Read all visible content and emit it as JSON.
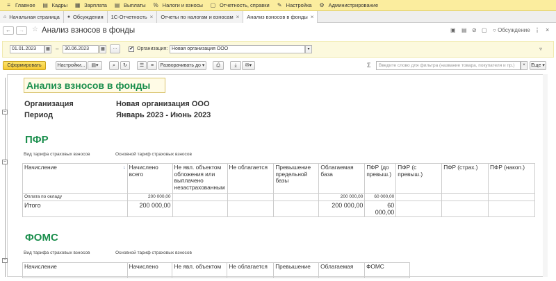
{
  "menu": [
    {
      "icon": "≡",
      "label": "Главное"
    },
    {
      "icon": "▤",
      "label": "Кадры"
    },
    {
      "icon": "▦",
      "label": "Зарплата"
    },
    {
      "icon": "▤",
      "label": "Выплаты"
    },
    {
      "icon": "%",
      "label": "Налоги и взносы"
    },
    {
      "icon": "▢",
      "label": "Отчетность, справки"
    },
    {
      "icon": "✎",
      "label": "Настройка"
    },
    {
      "icon": "⚙",
      "label": "Администрирование"
    }
  ],
  "tabs": [
    {
      "icon": "⌂",
      "label": "Начальная страница",
      "closable": false
    },
    {
      "icon": "●",
      "label": "Обсуждения",
      "closable": false
    },
    {
      "label": "1С-Отчетность",
      "closable": true
    },
    {
      "label": "Отчеты по налогам и взносам",
      "closable": true
    },
    {
      "label": "Анализ взносов в фонды",
      "closable": true
    }
  ],
  "window": {
    "title": "Анализ взносов в фонды",
    "discussion": "Обсуждение"
  },
  "filter": {
    "date_from": "01.01.2023",
    "date_to": "30.06.2023",
    "dots": "...",
    "org_label": "Организация:",
    "org_value": "Новая организация ООО",
    "org_checked": "✔"
  },
  "toolbar": {
    "generate": "Сформировать",
    "settings": "Настройки...",
    "expand": "Разворачивать до",
    "search_placeholder": "Введите слово для фильтра (название товара, покупателя и пр.)",
    "more": "Еще"
  },
  "report": {
    "title": "Анализ взносов в фонды",
    "org_label": "Организация",
    "org_value": "Новая организация ООО",
    "period_label": "Период",
    "period_value": "Январь 2023 - Июнь 2023",
    "pfr": {
      "heading": "ПФР",
      "tariff_label": "Вид тарифа страховых взносов",
      "tariff_value": "Основной тариф страховых взносов",
      "headers": [
        "Начисление",
        "Начислено всего",
        "Не явл. объектом обложения или выплачено незастрахованным",
        "Не облагается",
        "Превышение предельной базы",
        "Облагаемая база",
        "ПФР (до превыш.)",
        "ПФР (с превыш.)",
        "ПФР (страх.)",
        "ПФР (накоп.)"
      ],
      "sort_marker": "↓",
      "rows": [
        [
          "Оплата по окладу",
          "200 000,00",
          "",
          "",
          "",
          "200 000,00",
          "60 000,00",
          "",
          "",
          ""
        ]
      ],
      "total": [
        "Итого",
        "200 000,00",
        "",
        "",
        "",
        "200 000,00",
        "60 000,00",
        "",
        "",
        ""
      ]
    },
    "foms": {
      "heading": "ФОМС",
      "tariff_label": "Вид тарифа страховых взносов",
      "tariff_value": "Основной тариф страховых взносов",
      "headers": [
        "Начисление",
        "Начислено",
        "Не явл. объектом",
        "Не облагается",
        "Превышение",
        "Облагаемая",
        "ФОМС"
      ]
    }
  }
}
